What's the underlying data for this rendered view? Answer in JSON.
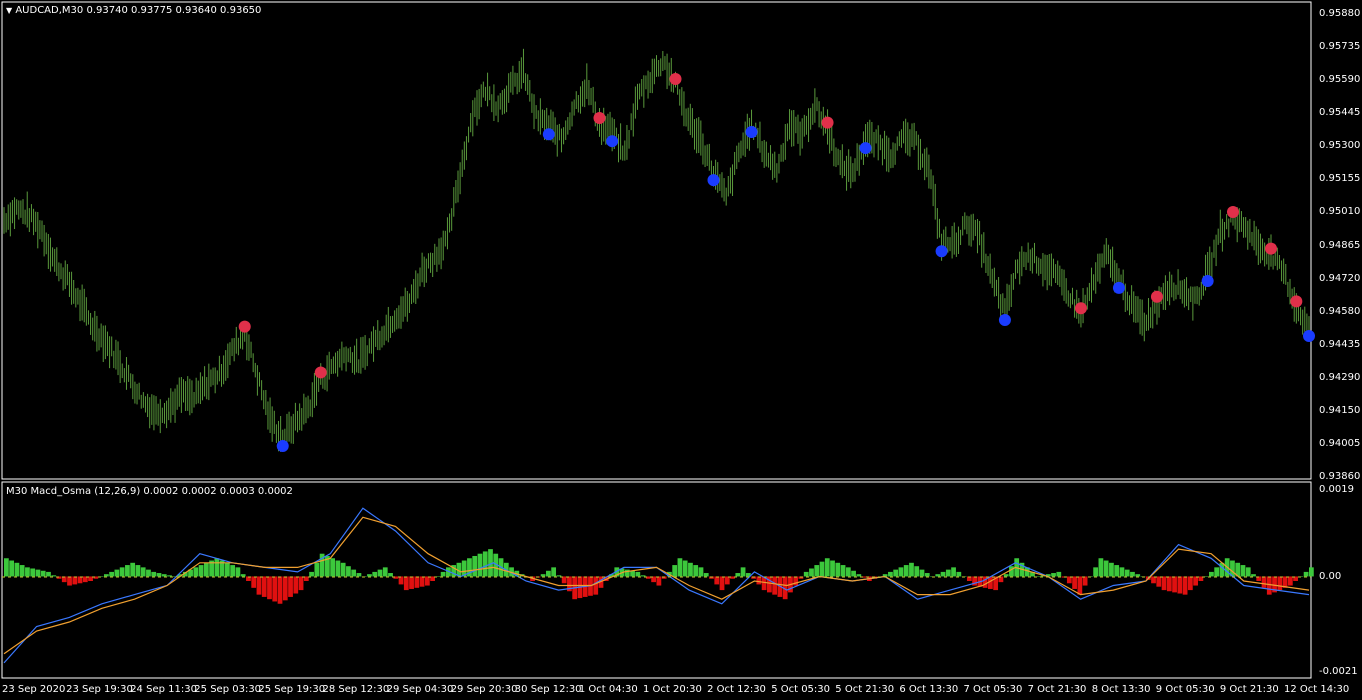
{
  "main_chart": {
    "symbol_label": "AUDCAD,M30",
    "ohlc_values": "0.93740 0.93775 0.93640 0.93650",
    "collapse_icon": "triangle-down-icon",
    "y_axis_ticks": [
      "0.95880",
      "0.95735",
      "0.95590",
      "0.95445",
      "0.95300",
      "0.95155",
      "0.95010",
      "0.94865",
      "0.94720",
      "0.94580",
      "0.94435",
      "0.94290",
      "0.94150",
      "0.94005",
      "0.93860"
    ]
  },
  "sub_chart": {
    "indicator_label": "M30  Macd_Osma (12,26,9) 0.0002 0.0002 0.0003 0.0002",
    "y_axis_ticks": [
      "0.0019",
      "0.00",
      "-0.0021"
    ]
  },
  "x_axis_ticks": [
    "23 Sep 2020",
    "23 Sep 19:30",
    "24 Sep 11:30",
    "25 Sep 03:30",
    "25 Sep 19:30",
    "28 Sep 12:30",
    "29 Sep 04:30",
    "29 Sep 20:30",
    "30 Sep 12:30",
    "1 Oct 04:30",
    "1 Oct 20:30",
    "2 Oct 12:30",
    "5 Oct 05:30",
    "5 Oct 21:30",
    "6 Oct 13:30",
    "7 Oct 05:30",
    "7 Oct 21:30",
    "8 Oct 13:30",
    "9 Oct 05:30",
    "9 Oct 21:30",
    "12 Oct 14:30"
  ],
  "colors": {
    "background": "#000000",
    "bars": "#5a9a3c",
    "grid": "#ffffff",
    "sell_signal": "#e0304a",
    "buy_signal": "#1a3cff",
    "hist_up": "#3cc83c",
    "hist_down": "#e01010",
    "macd_line": "#3a78ff",
    "signal_line": "#f0a030",
    "zero_line": "#c8c832"
  },
  "chart_data": [
    {
      "type": "bar",
      "title": "AUDCAD,M30",
      "x_axis": "time",
      "ylim": [
        0.9386,
        0.9588
      ],
      "series": [
        {
          "name": "AUDCAD,M30",
          "values": [
            0.9498,
            0.9503,
            0.95,
            0.9493,
            0.948,
            0.9472,
            0.9462,
            0.9452,
            0.9445,
            0.9437,
            0.9428,
            0.9419,
            0.9414,
            0.9416,
            0.9422,
            0.942,
            0.9427,
            0.9431,
            0.9441,
            0.9449,
            0.943,
            0.9411,
            0.9403,
            0.941,
            0.9416,
            0.9429,
            0.9435,
            0.944,
            0.9436,
            0.9444,
            0.945,
            0.9457,
            0.9462,
            0.9476,
            0.9482,
            0.949,
            0.9518,
            0.9545,
            0.9555,
            0.9548,
            0.9556,
            0.9563,
            0.9543,
            0.9539,
            0.9533,
            0.9548,
            0.9557,
            0.954,
            0.9536,
            0.9527,
            0.9552,
            0.956,
            0.9568,
            0.9557,
            0.9542,
            0.9533,
            0.9519,
            0.9508,
            0.9527,
            0.954,
            0.9528,
            0.952,
            0.954,
            0.9535,
            0.9548,
            0.9538,
            0.9522,
            0.9519,
            0.9533,
            0.9532,
            0.9527,
            0.9534,
            0.9532,
            0.952,
            0.9488,
            0.9488,
            0.9497,
            0.949,
            0.9472,
            0.9458,
            0.9478,
            0.9483,
            0.9478,
            0.9474,
            0.9466,
            0.9457,
            0.9471,
            0.9483,
            0.9472,
            0.9461,
            0.9453,
            0.9462,
            0.947,
            0.9468,
            0.9463,
            0.9475,
            0.9493,
            0.9499,
            0.9495,
            0.9487,
            0.9483,
            0.9475,
            0.946,
            0.9451
          ],
          "marker": "ohlc-bar"
        }
      ],
      "annotations": {
        "sell_signal_count": 10,
        "buy_signal_count": 11
      }
    },
    {
      "type": "line",
      "title": "Macd_Osma (12,26,9)",
      "ylim": [
        -0.0021,
        0.0019
      ],
      "series": [
        {
          "name": "histogram",
          "values": [
            0.0004,
            0.0002,
            0.0001,
            -0.0002,
            -0.0001,
            0.0001,
            0.0003,
            0.0001,
            0.0,
            0.0002,
            0.0004,
            0.0002,
            -0.0004,
            -0.0006,
            -0.0003,
            0.0005,
            0.0003,
            0.0,
            0.0002,
            -0.0003,
            -0.0002,
            0.0002,
            0.0004,
            0.0006,
            0.0002,
            -0.0001,
            0.0002,
            -0.0005,
            -0.0004,
            0.0002,
            0.0001,
            -0.0002,
            0.0004,
            0.0002,
            -0.0003,
            0.0002,
            -0.0003,
            -0.0005,
            0.0001,
            0.0004,
            0.0002,
            -0.0001,
            0.0001,
            0.0003,
            0.0,
            0.0002,
            -0.0002,
            -0.0003,
            0.0004,
            0.0,
            0.0001,
            -0.0004,
            0.0004,
            0.0002,
            0.0,
            -0.0003,
            -0.0004,
            0.0,
            0.0004,
            0.0002,
            -0.0004,
            -0.0002,
            0.0002
          ]
        },
        {
          "name": "macd",
          "values": [
            -0.0019,
            -0.0011,
            -0.0009,
            -0.0006,
            -0.0004,
            -0.0002,
            0.0005,
            0.0003,
            0.0002,
            0.0001,
            0.0005,
            0.0015,
            0.001,
            0.0003,
            0.0,
            0.0003,
            -0.0001,
            -0.0003,
            -0.0002,
            0.0002,
            0.0002,
            -0.0003,
            -0.0006,
            0.0001,
            -0.0003,
            0.0,
            -0.0001,
            0.0,
            -0.0005,
            -0.0003,
            -0.0001,
            0.0003,
            0.0,
            -0.0005,
            -0.0002,
            -0.0001,
            0.0007,
            0.0004,
            -0.0002,
            -0.0003,
            -0.0004
          ]
        },
        {
          "name": "signal",
          "values": [
            -0.0017,
            -0.0012,
            -0.001,
            -0.0007,
            -0.0005,
            -0.0002,
            0.0003,
            0.0003,
            0.0002,
            0.0002,
            0.0004,
            0.0013,
            0.0011,
            0.0005,
            0.0001,
            0.0002,
            0.0,
            -0.0002,
            -0.0002,
            0.0001,
            0.0002,
            -0.0002,
            -0.0005,
            -0.0001,
            -0.0002,
            0.0,
            -0.0001,
            0.0,
            -0.0004,
            -0.0004,
            -0.0002,
            0.0002,
            0.0,
            -0.0004,
            -0.0003,
            -0.0001,
            0.0006,
            0.0005,
            -0.0001,
            -0.0002,
            -0.0003
          ]
        }
      ]
    }
  ]
}
